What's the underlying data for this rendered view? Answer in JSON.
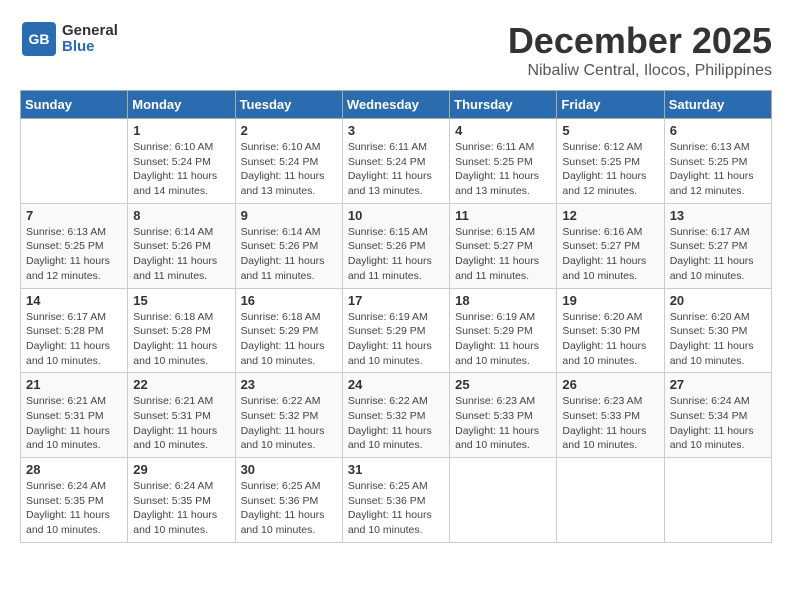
{
  "header": {
    "logo_general": "General",
    "logo_blue": "Blue",
    "month": "December 2025",
    "location": "Nibaliw Central, Ilocos, Philippines"
  },
  "weekdays": [
    "Sunday",
    "Monday",
    "Tuesday",
    "Wednesday",
    "Thursday",
    "Friday",
    "Saturday"
  ],
  "weeks": [
    [
      {
        "day": "",
        "info": ""
      },
      {
        "day": "1",
        "info": "Sunrise: 6:10 AM\nSunset: 5:24 PM\nDaylight: 11 hours\nand 14 minutes."
      },
      {
        "day": "2",
        "info": "Sunrise: 6:10 AM\nSunset: 5:24 PM\nDaylight: 11 hours\nand 13 minutes."
      },
      {
        "day": "3",
        "info": "Sunrise: 6:11 AM\nSunset: 5:24 PM\nDaylight: 11 hours\nand 13 minutes."
      },
      {
        "day": "4",
        "info": "Sunrise: 6:11 AM\nSunset: 5:25 PM\nDaylight: 11 hours\nand 13 minutes."
      },
      {
        "day": "5",
        "info": "Sunrise: 6:12 AM\nSunset: 5:25 PM\nDaylight: 11 hours\nand 12 minutes."
      },
      {
        "day": "6",
        "info": "Sunrise: 6:13 AM\nSunset: 5:25 PM\nDaylight: 11 hours\nand 12 minutes."
      }
    ],
    [
      {
        "day": "7",
        "info": "Sunrise: 6:13 AM\nSunset: 5:25 PM\nDaylight: 11 hours\nand 12 minutes."
      },
      {
        "day": "8",
        "info": "Sunrise: 6:14 AM\nSunset: 5:26 PM\nDaylight: 11 hours\nand 11 minutes."
      },
      {
        "day": "9",
        "info": "Sunrise: 6:14 AM\nSunset: 5:26 PM\nDaylight: 11 hours\nand 11 minutes."
      },
      {
        "day": "10",
        "info": "Sunrise: 6:15 AM\nSunset: 5:26 PM\nDaylight: 11 hours\nand 11 minutes."
      },
      {
        "day": "11",
        "info": "Sunrise: 6:15 AM\nSunset: 5:27 PM\nDaylight: 11 hours\nand 11 minutes."
      },
      {
        "day": "12",
        "info": "Sunrise: 6:16 AM\nSunset: 5:27 PM\nDaylight: 11 hours\nand 10 minutes."
      },
      {
        "day": "13",
        "info": "Sunrise: 6:17 AM\nSunset: 5:27 PM\nDaylight: 11 hours\nand 10 minutes."
      }
    ],
    [
      {
        "day": "14",
        "info": "Sunrise: 6:17 AM\nSunset: 5:28 PM\nDaylight: 11 hours\nand 10 minutes."
      },
      {
        "day": "15",
        "info": "Sunrise: 6:18 AM\nSunset: 5:28 PM\nDaylight: 11 hours\nand 10 minutes."
      },
      {
        "day": "16",
        "info": "Sunrise: 6:18 AM\nSunset: 5:29 PM\nDaylight: 11 hours\nand 10 minutes."
      },
      {
        "day": "17",
        "info": "Sunrise: 6:19 AM\nSunset: 5:29 PM\nDaylight: 11 hours\nand 10 minutes."
      },
      {
        "day": "18",
        "info": "Sunrise: 6:19 AM\nSunset: 5:29 PM\nDaylight: 11 hours\nand 10 minutes."
      },
      {
        "day": "19",
        "info": "Sunrise: 6:20 AM\nSunset: 5:30 PM\nDaylight: 11 hours\nand 10 minutes."
      },
      {
        "day": "20",
        "info": "Sunrise: 6:20 AM\nSunset: 5:30 PM\nDaylight: 11 hours\nand 10 minutes."
      }
    ],
    [
      {
        "day": "21",
        "info": "Sunrise: 6:21 AM\nSunset: 5:31 PM\nDaylight: 11 hours\nand 10 minutes."
      },
      {
        "day": "22",
        "info": "Sunrise: 6:21 AM\nSunset: 5:31 PM\nDaylight: 11 hours\nand 10 minutes."
      },
      {
        "day": "23",
        "info": "Sunrise: 6:22 AM\nSunset: 5:32 PM\nDaylight: 11 hours\nand 10 minutes."
      },
      {
        "day": "24",
        "info": "Sunrise: 6:22 AM\nSunset: 5:32 PM\nDaylight: 11 hours\nand 10 minutes."
      },
      {
        "day": "25",
        "info": "Sunrise: 6:23 AM\nSunset: 5:33 PM\nDaylight: 11 hours\nand 10 minutes."
      },
      {
        "day": "26",
        "info": "Sunrise: 6:23 AM\nSunset: 5:33 PM\nDaylight: 11 hours\nand 10 minutes."
      },
      {
        "day": "27",
        "info": "Sunrise: 6:24 AM\nSunset: 5:34 PM\nDaylight: 11 hours\nand 10 minutes."
      }
    ],
    [
      {
        "day": "28",
        "info": "Sunrise: 6:24 AM\nSunset: 5:35 PM\nDaylight: 11 hours\nand 10 minutes."
      },
      {
        "day": "29",
        "info": "Sunrise: 6:24 AM\nSunset: 5:35 PM\nDaylight: 11 hours\nand 10 minutes."
      },
      {
        "day": "30",
        "info": "Sunrise: 6:25 AM\nSunset: 5:36 PM\nDaylight: 11 hours\nand 10 minutes."
      },
      {
        "day": "31",
        "info": "Sunrise: 6:25 AM\nSunset: 5:36 PM\nDaylight: 11 hours\nand 10 minutes."
      },
      {
        "day": "",
        "info": ""
      },
      {
        "day": "",
        "info": ""
      },
      {
        "day": "",
        "info": ""
      }
    ]
  ]
}
